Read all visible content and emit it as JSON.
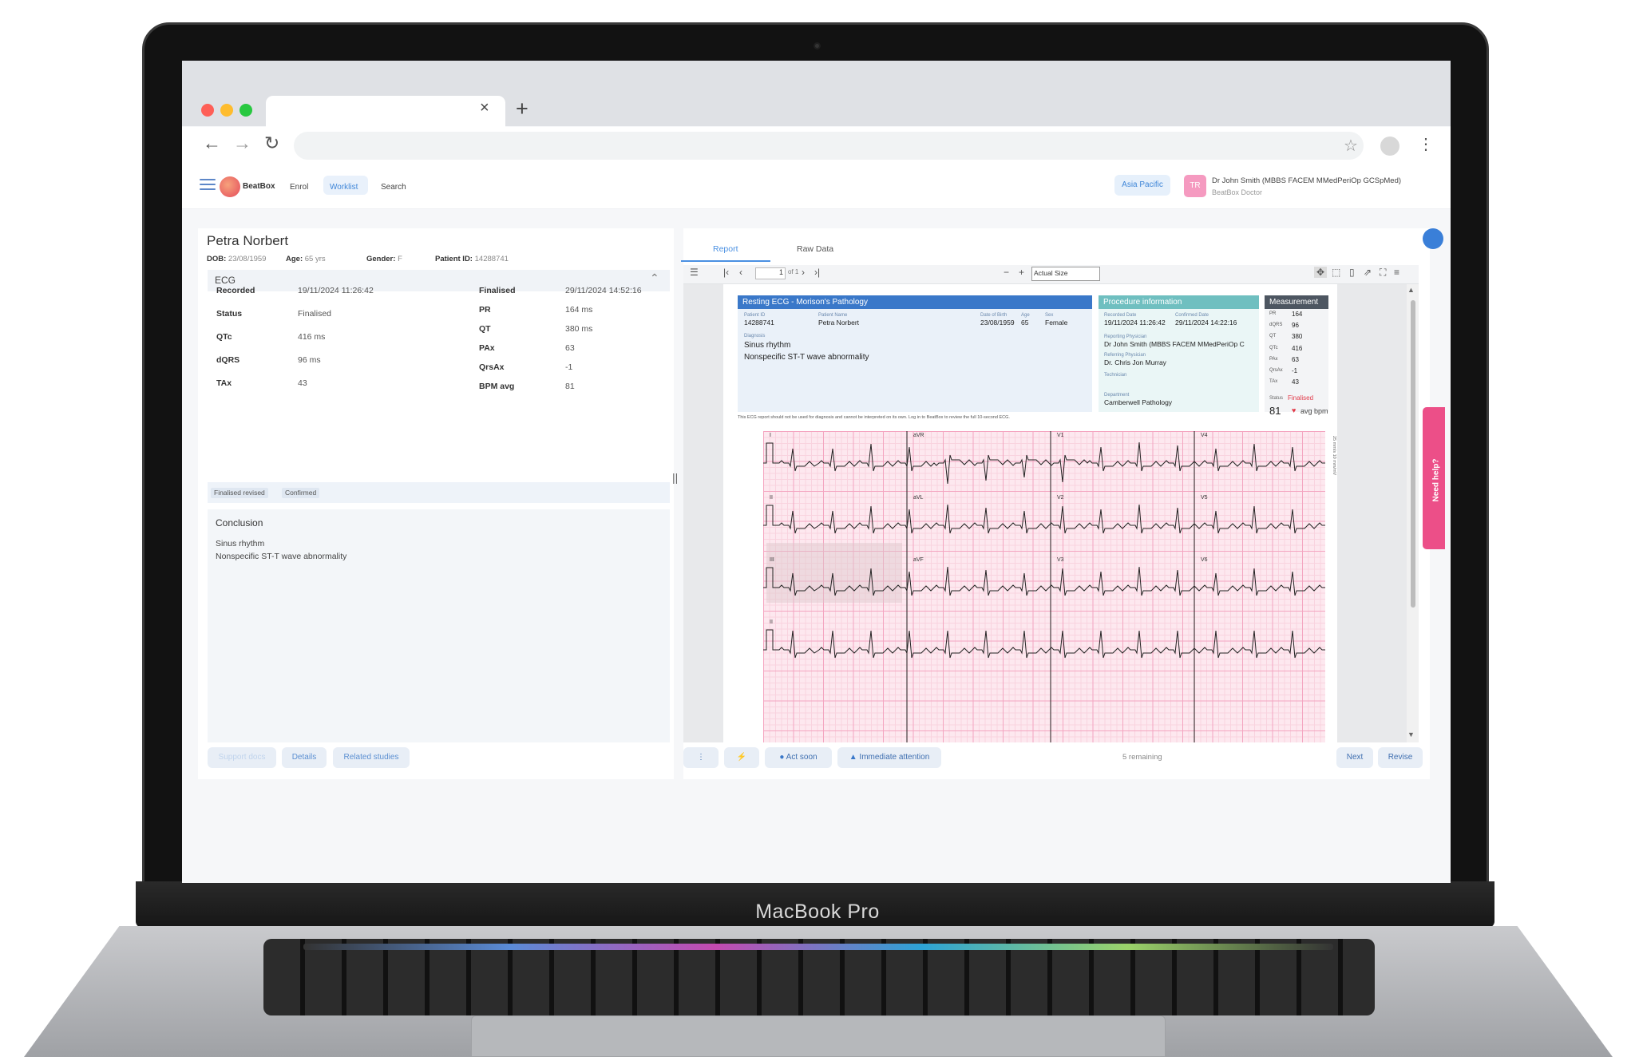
{
  "device": {
    "brand": "MacBook Pro"
  },
  "browser": {
    "tab_close": "×",
    "new_tab": "+"
  },
  "app": {
    "logo_text": "BeatBox",
    "nav": [
      "Enrol",
      "Worklist",
      "Search"
    ],
    "region": "Asia Pacific",
    "user_initials": "TR",
    "user_name": "Dr John Smith (MBBS FACEM MMedPeriOp GCSpMed)",
    "user_role": "BeatBox Doctor"
  },
  "patient": {
    "name": "Petra Norbert",
    "dob_label": "DOB:",
    "dob": "23/08/1959",
    "age_label": "Age:",
    "age": "65 yrs",
    "gender_label": "Gender:",
    "gender": "F",
    "id_label": "Patient ID:",
    "id": "14288741"
  },
  "ecg": {
    "section": "ECG",
    "left": [
      {
        "label": "Recorded",
        "value": "19/11/2024 11:26:42"
      },
      {
        "label": "Status",
        "value": "Finalised"
      },
      {
        "label": "QTc",
        "value": "416 ms"
      },
      {
        "label": "dQRS",
        "value": "96 ms"
      },
      {
        "label": "TAx",
        "value": "43"
      }
    ],
    "right": [
      {
        "label": "Finalised",
        "value": "29/11/2024 14:52:16"
      },
      {
        "label": "PR",
        "value": "164 ms"
      },
      {
        "label": "QT",
        "value": "380 ms"
      },
      {
        "label": "PAx",
        "value": "63"
      },
      {
        "label": "QrsAx",
        "value": "-1"
      },
      {
        "label": "BPM avg",
        "value": "81"
      }
    ],
    "badges": [
      "Finalised revised",
      "Confirmed"
    ],
    "conclusion_title": "Conclusion",
    "conclusion": [
      "Sinus rhythm",
      "Nonspecific ST-T wave abnormality"
    ],
    "buttons": [
      "Support docs",
      "Details",
      "Related studies"
    ]
  },
  "viewer": {
    "tabs": [
      "Report",
      "Raw Data"
    ],
    "page": "1",
    "of": "of 1",
    "zoom": "Actual Size",
    "footer": {
      "act_soon": "Act soon",
      "immediate": "Immediate attention",
      "remaining": "5 remaining",
      "next": "Next",
      "revise": "Revise"
    },
    "help": "Need help?"
  },
  "report": {
    "title": "Resting ECG -  Morison's Pathology",
    "patient_id_label": "Patient ID",
    "patient_id": "14288741",
    "patient_name_label": "Patient Name",
    "patient_name": "Petra  Norbert",
    "dob_label": "Date of Birth",
    "dob": "23/08/1959",
    "age_label": "Age",
    "age": "65",
    "sex_label": "Sex",
    "sex": "Female",
    "diagnosis_label": "Diagnosis",
    "diagnosis": [
      "Sinus rhythm",
      "Nonspecific ST-T wave abnormality"
    ],
    "proc_title": "Procedure information",
    "recorded_label": "Recorded Date",
    "recorded": "19/11/2024 11:26:42",
    "confirmed_label": "Confirmed Date",
    "confirmed": "29/11/2024 14:22:16",
    "reporting_label": "Reporting Physician",
    "reporting": "Dr John Smith (MBBS FACEM MMedPeriOp C",
    "referring_label": "Referring Physician",
    "referring": "Dr. Chris Jon Murray",
    "technician_label": "Technician",
    "department_label": "Department",
    "department": "Camberwell Pathology",
    "meas_title": "Measurement",
    "measurements": [
      {
        "k": "PR",
        "v": "164"
      },
      {
        "k": "dQRS",
        "v": "96"
      },
      {
        "k": "QT",
        "v": "380"
      },
      {
        "k": "QTc",
        "v": "416"
      },
      {
        "k": "PAx",
        "v": "63"
      },
      {
        "k": "QrsAx",
        "v": "-1"
      },
      {
        "k": "TAx",
        "v": "43"
      }
    ],
    "status_label": "Status",
    "status": "Finalised",
    "bpm": "81",
    "bpm_label": "avg bpm",
    "disclaimer": "This ECG report should not be used for diagnosis and cannot be interpreted on its own. Log in to BeatBox to review the full 10-second ECG.",
    "speed": "25 mm/s 10 mm/mV",
    "leads": [
      "I",
      "aVR",
      "V1",
      "V4",
      "II",
      "aVL",
      "V2",
      "V5",
      "III",
      "aVF",
      "V3",
      "V6",
      "II"
    ]
  },
  "colors": {
    "accent": "#4a90e2",
    "report_blue": "#3a78c9",
    "report_teal": "#6fbfc0",
    "status_red": "#e23b4a",
    "help_pink": "#ec4f88"
  }
}
